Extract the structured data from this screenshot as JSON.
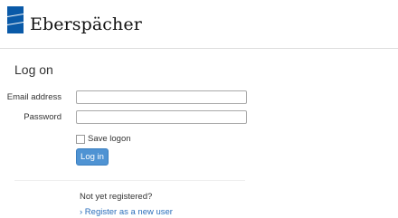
{
  "brand": {
    "name": "Eberspächer",
    "colors": {
      "mark": "#0a5aa8",
      "accent": "#4f93d3",
      "link": "#2a6ebb"
    }
  },
  "page": {
    "title": "Log on"
  },
  "form": {
    "email": {
      "label": "Email address",
      "value": "",
      "placeholder": ""
    },
    "password": {
      "label": "Password",
      "value": "",
      "placeholder": ""
    },
    "save_logon": {
      "label": "Save logon",
      "checked": false
    },
    "submit_label": "Log in"
  },
  "register": {
    "prompt": "Not yet registered?",
    "link_label": "› Register as a new user"
  }
}
